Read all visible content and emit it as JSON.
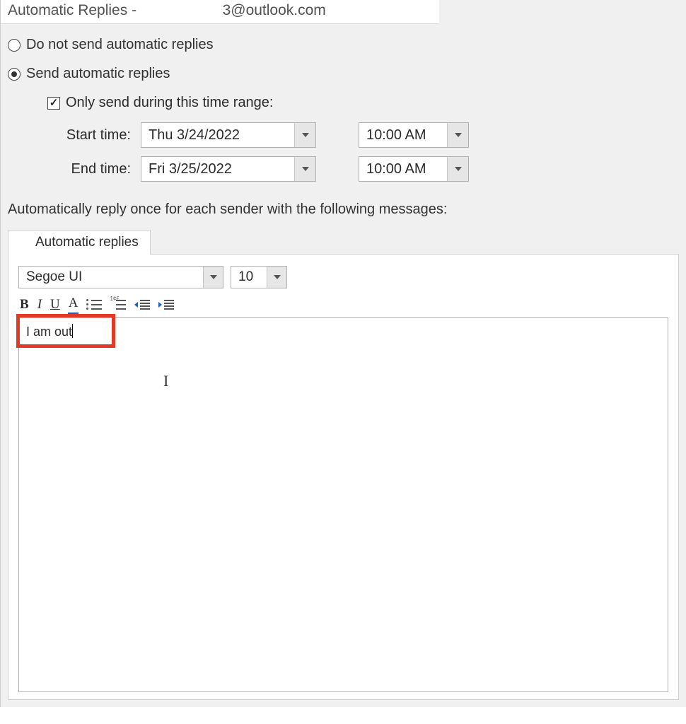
{
  "dialog": {
    "title_prefix": "Automatic Replies - ",
    "email_visible_suffix": "3@outlook.com"
  },
  "options": {
    "do_not_send_label": "Do not send automatic replies",
    "send_label": "Send automatic replies",
    "selected": "send",
    "time_range_label": "Only send during this time range:",
    "time_range_checked": true,
    "start_label": "Start time:",
    "end_label": "End time:",
    "start_date": "Thu 3/24/2022",
    "start_time": "10:00 AM",
    "end_date": "Fri 3/25/2022",
    "end_time": "10:00 AM"
  },
  "instruction": "Automatically reply once for each sender with the following messages:",
  "tab": {
    "label": "Automatic replies"
  },
  "editor": {
    "font_name": "Segoe UI",
    "font_size": "10",
    "message_text": "I am out"
  }
}
